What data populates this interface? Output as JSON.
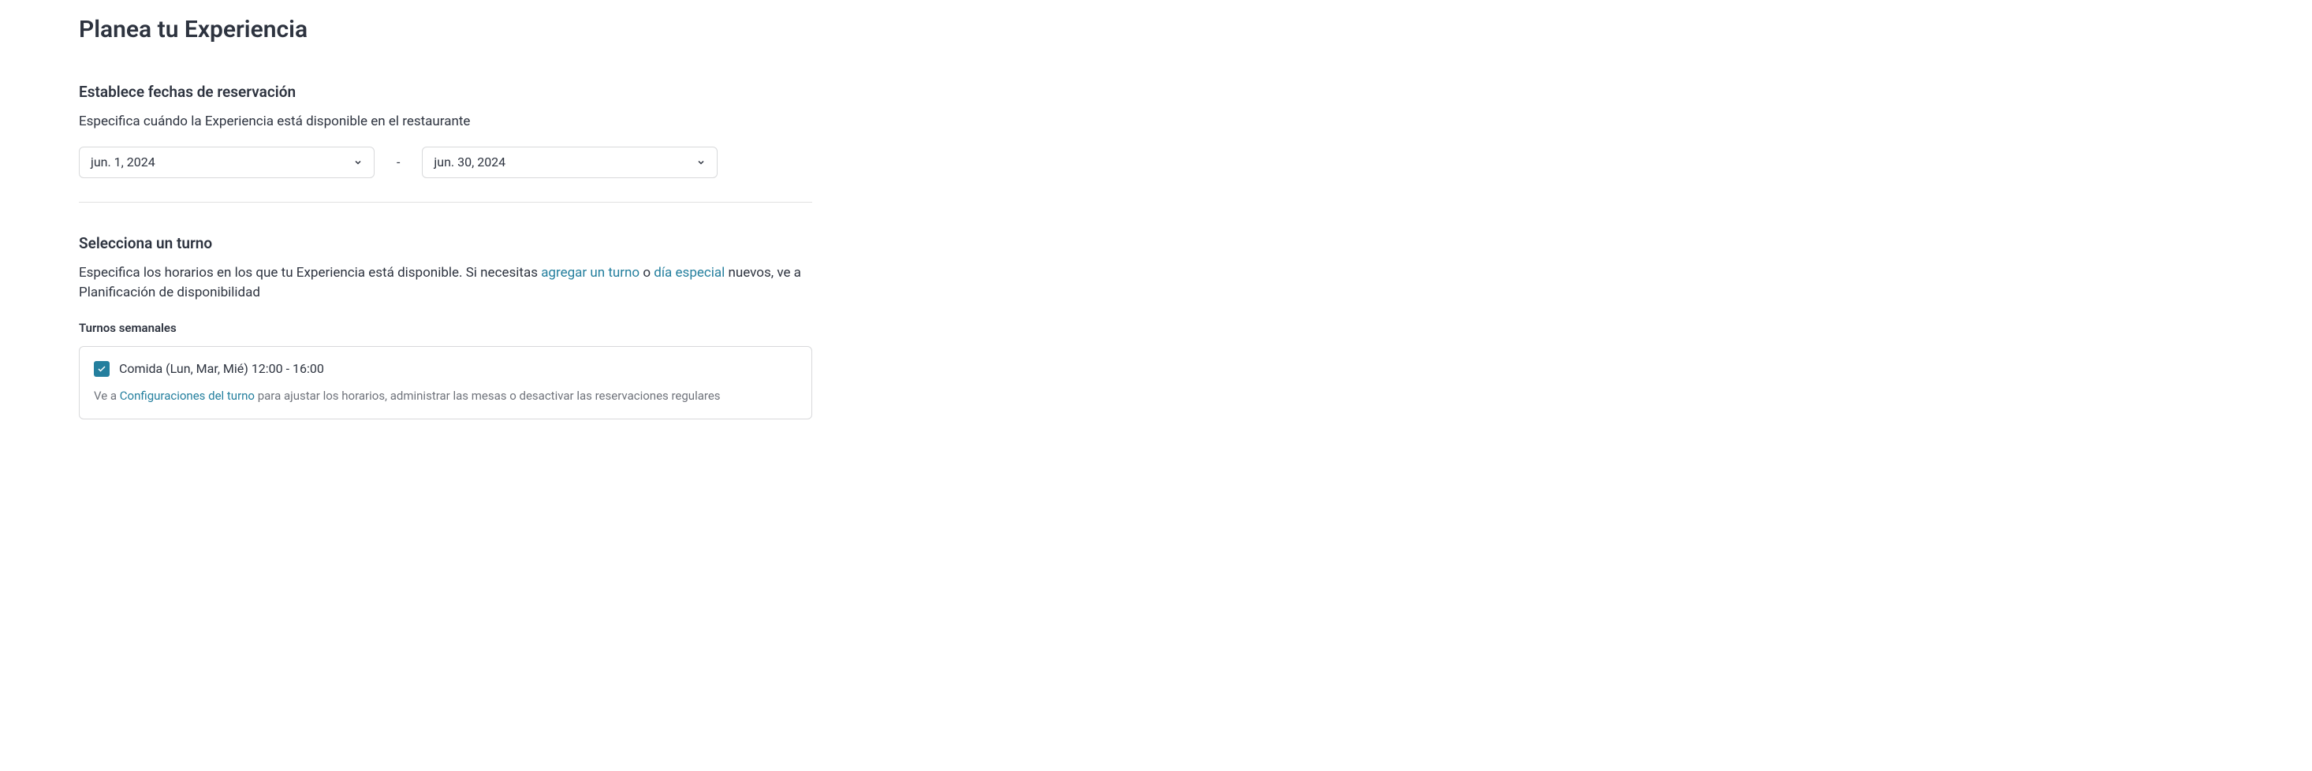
{
  "page": {
    "title": "Planea tu Experiencia"
  },
  "dates": {
    "heading": "Establece fechas de reservación",
    "description": "Especifica cuándo la Experiencia está disponible en el restaurante",
    "start": "jun. 1, 2024",
    "separator": "-",
    "end": "jun. 30, 2024"
  },
  "shifts": {
    "heading": "Selecciona un turno",
    "description_part1": "Especifica los horarios en los que tu Experiencia está disponible. Si necesitas ",
    "link_add_shift": "agregar un turno",
    "description_or": " o ",
    "link_special_day": "día especial",
    "description_part2": " nuevos, ve a Planificación de disponibilidad",
    "weekly_heading": "Turnos semanales",
    "item": {
      "label": "Comida (Lun, Mar, Mié) 12:00 - 16:00",
      "help_prefix": "Ve a ",
      "help_link": "Configuraciones del turno",
      "help_suffix": " para ajustar los horarios, administrar las mesas o desactivar las reservaciones regulares"
    }
  }
}
